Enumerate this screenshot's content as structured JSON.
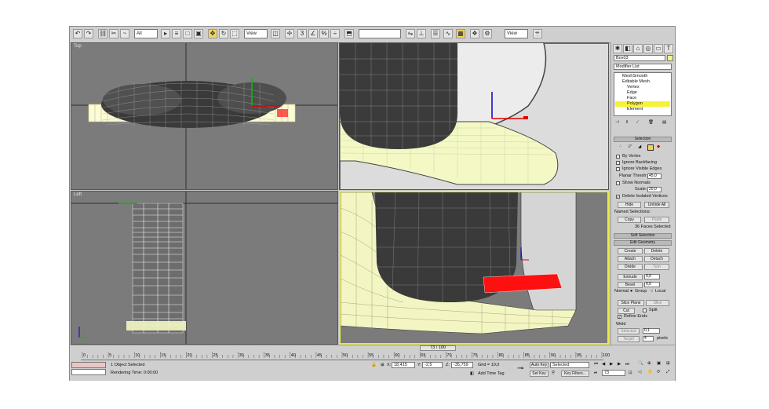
{
  "toolbar": {
    "selection_filter": "All",
    "reference_coord": "View",
    "named_selection": "",
    "render_view": "View"
  },
  "viewports": {
    "top_label": "Top",
    "front_label": "",
    "left_label": "Left",
    "perspective_label": ""
  },
  "command_panel": {
    "object_name": "Box03",
    "modifier_list": "Modifier List",
    "stack": [
      "MeshSmooth",
      "Editable Mesh",
      "Vertex",
      "Edge",
      "Face",
      "Polygon",
      "Element"
    ],
    "selection_title": "Selection",
    "by_vertex": "By Vertex",
    "ignore_backfacing": "Ignore Backfacing",
    "ignore_visible_edges": "Ignore Visible Edges",
    "planar_thresh_label": "Planar Thresh:",
    "planar_thresh_value": "45,0",
    "show_normals": "Show Normals",
    "scale_label": "Scale:",
    "scale_value": "20,0",
    "delete_isolated": "Delete Isolated Vertices",
    "hide": "Hide",
    "unhide_all": "Unhide All",
    "named_selections": "Named Selections:",
    "copy": "Copy",
    "paste": "Paste",
    "faces_selected": "36 Faces Selected",
    "soft_selection": "Soft Selection",
    "edit_geometry": "Edit Geometry",
    "create": "Create",
    "delete": "Delete",
    "attach": "Attach",
    "detach": "Detach",
    "divide": "Divide",
    "turn": "Turn",
    "extrude": "Extrude",
    "extrude_value": "0,0",
    "bevel": "Bevel",
    "bevel_value": "0,0",
    "normal_label": "Normal:",
    "group": "Group",
    "local": "Local",
    "slice_plane": "Slice Plane",
    "slice": "Slice",
    "cut": "Cut",
    "split": "Split",
    "refine_ends": "Refine Ends",
    "weld": "Weld",
    "selected": "Selected",
    "selected_value": "0,1",
    "target": "Target",
    "target_value": "4",
    "pixels": "pixels"
  },
  "timeline": {
    "frame_indicator": "73 / 100",
    "ticks": [
      "0",
      "5",
      "10",
      "15",
      "20",
      "25",
      "30",
      "35",
      "40",
      "45",
      "50",
      "55",
      "60",
      "65",
      "70",
      "75",
      "80",
      "85",
      "90",
      "95",
      "100"
    ]
  },
  "status": {
    "objects_selected": "1 Object Selected",
    "rendering_time": "Rendering Time: 0:00:00",
    "x_label": "X:",
    "x_value": "18,415",
    "y_label": "Y:",
    "y_value": "-2,5",
    "z_label": "Z:",
    "z_value": "-35,759",
    "grid": "Grid = 10,0",
    "add_time_tag": "Add Time Tag",
    "auto_key": "Auto Key",
    "set_key": "Set Key",
    "key_mode_value": "Selected",
    "key_filters": "Key Filters...",
    "current_frame": "73"
  },
  "colors": {
    "viewport_bg": "#7b7b7b",
    "ui_bg": "#cfcfcf",
    "active_border": "#e8e84a",
    "mesh_yellow": "#f4f7bf",
    "selected_poly": "#ff0000"
  }
}
